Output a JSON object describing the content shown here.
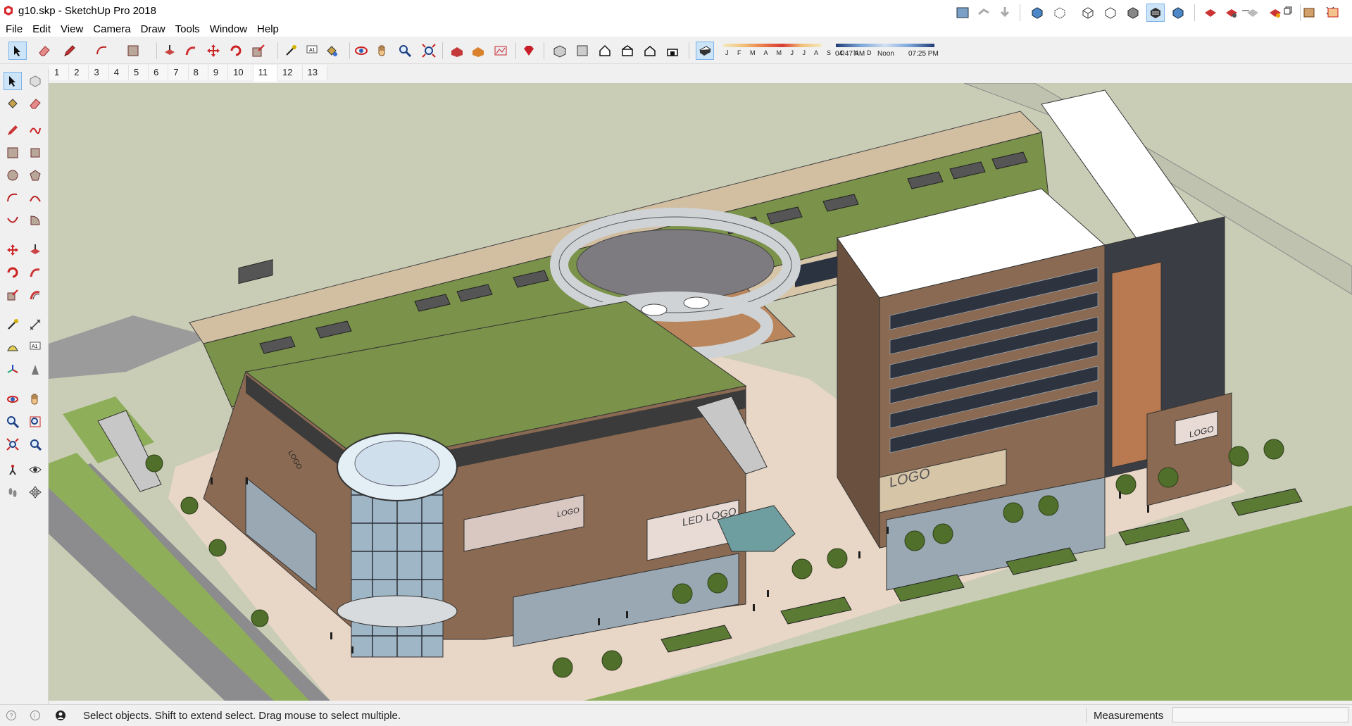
{
  "window": {
    "title": "g10.skp - SketchUp Pro 2018",
    "controls": [
      "minimize",
      "restore",
      "close"
    ]
  },
  "menu": [
    "File",
    "Edit",
    "View",
    "Camera",
    "Draw",
    "Tools",
    "Window",
    "Help"
  ],
  "shadows": {
    "months": "J F M A M J J A S O N D",
    "time_start": "04:47 AM",
    "time_mid": "Noon",
    "time_end": "07:25 PM"
  },
  "scenes": [
    "1",
    "2",
    "3",
    "4",
    "5",
    "6",
    "7",
    "8",
    "9",
    "10",
    "11",
    "12",
    "13"
  ],
  "active_scene": "11",
  "viewport_signs": {
    "led_logo": "LED LOGO",
    "logo_front": "LOGO",
    "logo_hotel": "LOGO",
    "logo_right": "LOGO",
    "logo_side": "LOGO"
  },
  "status": {
    "hint": "Select objects. Shift to extend select. Drag mouse to select multiple.",
    "measurements_label": "Measurements",
    "measurements_value": ""
  },
  "colors": {
    "roof_green": "#7a9249",
    "facade_brown": "#8a6a52",
    "plaza": "#e8d6c6",
    "lawn": "#8fae5a",
    "sky_ground": "#c9cdb6"
  }
}
